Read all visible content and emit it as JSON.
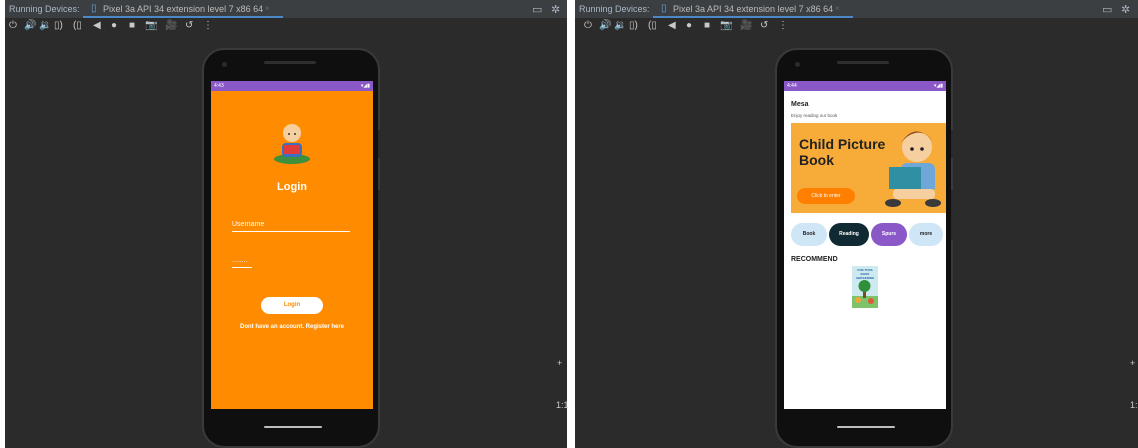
{
  "ide": {
    "running_devices_label": "Running Devices:",
    "device_tab_label": "Pixel 3a API 34 extension level 7 x86 64",
    "close_glyph": "×",
    "restore_glyph": "▭",
    "settings_glyph": "✲",
    "tab_accent_color": "#4a88c7",
    "toolbar_glyphs": [
      "⏻",
      "🔊",
      "🔉",
      "▯)",
      "(▯",
      "◀",
      "●",
      "■",
      "📷",
      "🎥",
      "↺",
      "⋮"
    ],
    "zoom": {
      "plus": "+",
      "ratio": "1:1"
    }
  },
  "login_screen": {
    "status_time": "4:43",
    "status_icons": "▾◢▮",
    "title": "Login",
    "username_placeholder": "Username",
    "password_placeholder": "........",
    "login_button": "Login",
    "register_text": "Dont have an account. Register here",
    "background_color": "#ff8c00"
  },
  "home_screen": {
    "status_time": "4:44",
    "status_icons": "▾◢▮",
    "app_title": "Mesa",
    "subtitle": "Enjoy reading our book",
    "banner": {
      "title": "Child Picture Book",
      "button": "Click to enter",
      "background_color": "#f7ac3a"
    },
    "categories": [
      "Book",
      "Reading",
      "Spurs",
      "more"
    ],
    "recommend_label": "RECOMMEND",
    "recommended_book_title": "FOR TOSS BOOK AWAKENING"
  }
}
